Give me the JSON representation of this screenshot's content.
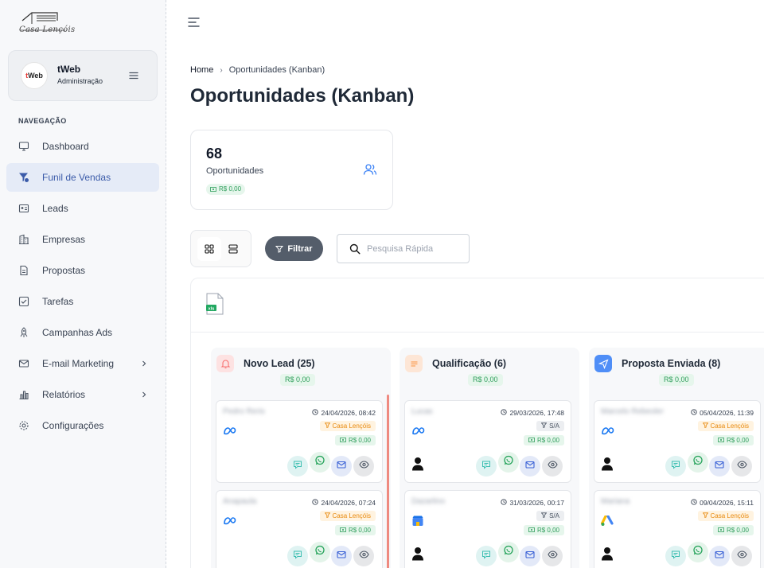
{
  "brand": {
    "logo_text": "Casa Lençóis"
  },
  "user": {
    "avatar_text": "tWeb",
    "name": "tWeb",
    "role": "Administração"
  },
  "nav": {
    "section_title": "NAVEGAÇÃO",
    "items": [
      {
        "label": "Dashboard",
        "icon": "monitor-icon"
      },
      {
        "label": "Funil de Vendas",
        "icon": "funnel-icon",
        "active": true
      },
      {
        "label": "Leads",
        "icon": "id-card-icon"
      },
      {
        "label": "Empresas",
        "icon": "building-icon"
      },
      {
        "label": "Propostas",
        "icon": "document-icon"
      },
      {
        "label": "Tarefas",
        "icon": "checkbox-icon"
      },
      {
        "label": "Campanhas Ads",
        "icon": "rocket-icon"
      },
      {
        "label": "E-mail Marketing",
        "icon": "envelope-icon",
        "has_submenu": true
      },
      {
        "label": "Relatórios",
        "icon": "bar-chart-icon",
        "has_submenu": true
      },
      {
        "label": "Configurações",
        "icon": "gear-icon"
      }
    ]
  },
  "breadcrumb": {
    "home": "Home",
    "current": "Oportunidades (Kanban)"
  },
  "page": {
    "title": "Oportunidades (Kanban)"
  },
  "stats": {
    "count": "68",
    "label": "Oportunidades",
    "total": "R$ 0,00"
  },
  "toolbar": {
    "filter_label": "Filtrar",
    "search_placeholder": "Pesquisa Rápida",
    "search_value": ""
  },
  "colors": {
    "accent": "#3b5ba9",
    "primary_button": "#545d6a",
    "money_green": "#2f9e5b",
    "company_orange": "#e8890c"
  },
  "columns": [
    {
      "title": "Novo Lead (25)",
      "total": "R$ 0,00",
      "icon": "bell-icon",
      "icon_color": "#f87171",
      "icon_bg": "#fde2e2",
      "cards": [
        {
          "name": "Pedro Reris",
          "date": "24/04/2026, 08:42",
          "source": "meta-icon",
          "tag": "Casa Lençóis",
          "tag_type": "company",
          "value": "R$ 0,00",
          "has_person": false
        },
        {
          "name": "Anapaula",
          "date": "24/04/2026, 07:24",
          "source": "meta-icon",
          "tag": "Casa Lençóis",
          "tag_type": "company",
          "value": "R$ 0,00",
          "has_person": false
        }
      ]
    },
    {
      "title": "Qualificação (6)",
      "total": "R$ 0,00",
      "icon": "list-icon",
      "icon_color": "#fb923c",
      "icon_bg": "#fde6d6",
      "cards": [
        {
          "name": "Lucas",
          "date": "29/03/2026, 17:48",
          "source": "meta-icon",
          "tag": "S/A",
          "tag_type": "none",
          "value": "R$ 0,00",
          "has_person": true
        },
        {
          "name": "Dazarlino",
          "date": "31/03/2026, 00:17",
          "source": "google-business-icon",
          "tag": "S/A",
          "tag_type": "none",
          "value": "R$ 0,00",
          "has_person": true
        }
      ]
    },
    {
      "title": "Proposta Enviada (8)",
      "total": "R$ 0,00",
      "icon": "send-icon",
      "icon_color": "#ffffff",
      "icon_bg": "#4f8ef7",
      "cards": [
        {
          "name": "Marcelo Rebeoler",
          "date": "05/04/2026, 11:39",
          "source": "meta-icon",
          "tag": "Casa Lençóis",
          "tag_type": "company",
          "value": "R$ 0,00",
          "has_person": true
        },
        {
          "name": "Mariana",
          "date": "09/04/2026, 15:11",
          "source": "google-ads-icon",
          "tag": "Casa Lençóis",
          "tag_type": "company",
          "value": "R$ 0,00",
          "has_person": true
        }
      ]
    }
  ]
}
